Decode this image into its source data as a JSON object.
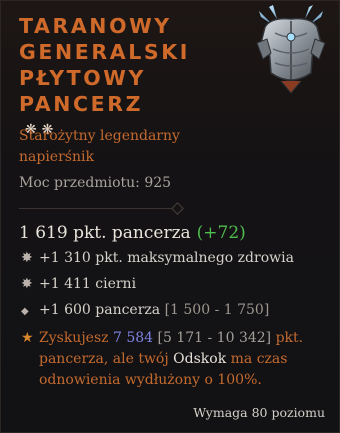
{
  "item": {
    "title_lines": [
      "Taranowy",
      "generalski",
      "płytowy",
      "pancerz"
    ],
    "aspect_glyphs": "❋ ❋",
    "icon": "chest-armor-icon",
    "rarity_line_1": "Starożytny legendarny",
    "rarity_line_2": "napierśnik",
    "power": "Moc przedmiotu: 925"
  },
  "armor": {
    "value": "1 619 pkt. pancerza",
    "gain": "(+72)"
  },
  "stats": [
    {
      "icon": "greater-affix-icon",
      "bullet": "✸",
      "text": "+1 310 pkt. maksymalnego zdrowia",
      "range": ""
    },
    {
      "icon": "greater-affix-icon",
      "bullet": "✸",
      "text": "+1 411 cierni",
      "range": ""
    },
    {
      "icon": "affix-diamond-icon",
      "bullet": "◆",
      "text": "+1 600 pancerza ",
      "range": "[1 500 - 1 750]"
    }
  ],
  "legendary": {
    "icon": "legendary-star-icon",
    "bullet": "★",
    "t1": "Zyskujesz ",
    "v1": "7 584",
    "r1": " [5 171 - 10 342]",
    "t2": " pkt. pancerza, ale twój ",
    "skill": "Odskok",
    "t3": " ma czas odnowienia wydłużony o 100%."
  },
  "requirement": "Wymaga 80 poziomu",
  "colors": {
    "legendary": "#cf6a2b",
    "gain": "#4fbc4f",
    "value_highlight": "#7d83e0"
  }
}
